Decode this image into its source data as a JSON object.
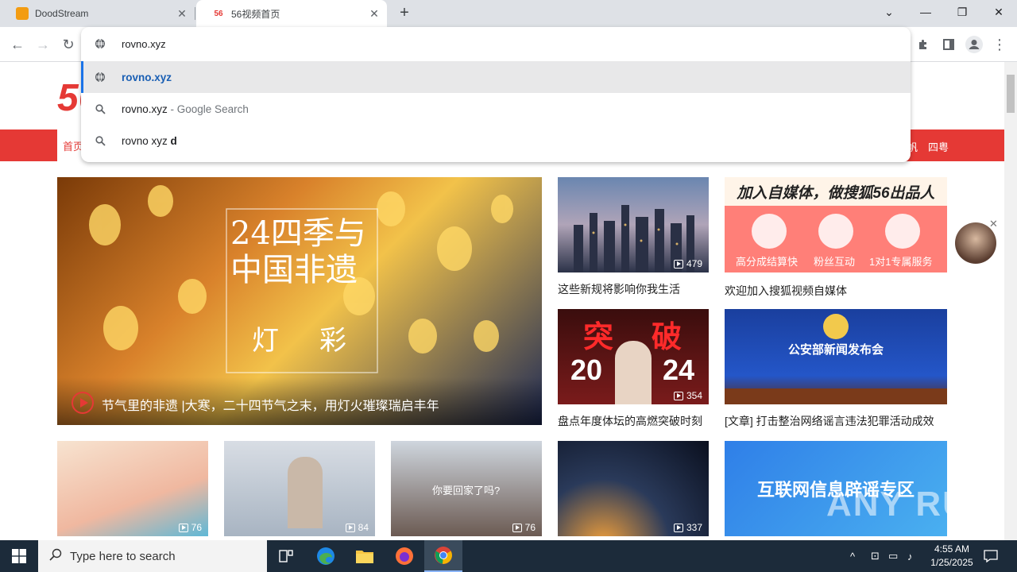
{
  "tabs": [
    {
      "title": "DoodStream",
      "active": false,
      "favicon_color": "#f39c12"
    },
    {
      "title": "56视频首页",
      "active": true,
      "favicon_text": "56",
      "favicon_color": "#e53935"
    }
  ],
  "omnibox": {
    "input_value": "rovno.xyz",
    "suggestions": [
      {
        "icon": "globe-icon",
        "text": "rovno.xyz",
        "suffix": "",
        "selected": true
      },
      {
        "icon": "search-icon",
        "text": "rovno.xyz",
        "suffix": " - Google Search",
        "selected": false
      },
      {
        "icon": "search-icon",
        "text": "rovno xyz ",
        "suffix": "d",
        "selected": false
      }
    ]
  },
  "site": {
    "logo": "56",
    "nav_home": "首页",
    "nav_right": [
      "帆",
      "四粤"
    ],
    "brand_color": "#e53935"
  },
  "hero": {
    "title_overlay": [
      "24四季与",
      "中国非遗"
    ],
    "sub_overlay": [
      "灯",
      "彩"
    ],
    "caption": "节气里的非遗 |大寒，二十四节气之末，用灯火璀璨瑞启丰年"
  },
  "cards": [
    {
      "caption": "这些新规将影响你我生活",
      "count": "479"
    },
    {
      "caption": "欢迎加入搜狐视频自媒体",
      "count": ""
    },
    {
      "caption": "盘点年度体坛的高燃突破时刻",
      "count": "354"
    },
    {
      "caption": "[文章] 打击整治网络谣言违法犯罪活动成效",
      "count": ""
    }
  ],
  "bottom_cards": [
    {
      "count": "76"
    },
    {
      "count": "84"
    },
    {
      "count": "76"
    },
    {
      "count": "337"
    },
    {
      "count": ""
    }
  ],
  "ad_banner": {
    "headline": "加入自媒体，做搜狐56出品人",
    "items": [
      "高分成结算快",
      "粉丝互动",
      "1对1专属服务"
    ]
  },
  "police_banner": {
    "title": "公安部新闻发布会"
  },
  "rumor_banner": {
    "title": "互联网信息辟谣专区"
  },
  "card3_text": [
    "突",
    "破",
    "20",
    "24"
  ],
  "card_overlay_text": "你要回家了吗?",
  "taskbar": {
    "search_placeholder": "Type here to search",
    "time": "4:55 AM",
    "date": "1/25/2025"
  },
  "watermark": "ANY RUN"
}
